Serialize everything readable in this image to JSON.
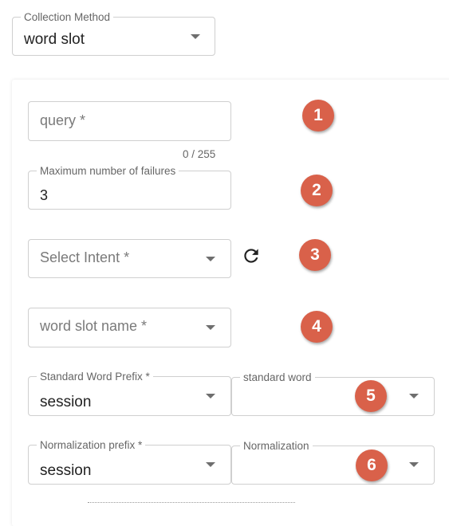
{
  "collection_method": {
    "label": "Collection Method",
    "value": "word slot"
  },
  "query": {
    "placeholder": "query *",
    "counter": "0 / 255"
  },
  "max_failures": {
    "label": "Maximum number of failures",
    "value": "3"
  },
  "intent": {
    "placeholder": "Select Intent *"
  },
  "word_slot_name": {
    "placeholder": "word slot name *"
  },
  "standard_word_prefix": {
    "label": "Standard Word Prefix *",
    "value": "session"
  },
  "standard_word": {
    "label": "standard word",
    "value": ""
  },
  "normalization_prefix": {
    "label": "Normalization prefix *",
    "value": "session"
  },
  "normalization": {
    "label": "Normalization",
    "value": ""
  },
  "badges": [
    "1",
    "2",
    "3",
    "4",
    "5",
    "6"
  ],
  "colors": {
    "badge": "#d9614a",
    "border": "#cfcfcf"
  },
  "icons": {
    "refresh": "refresh-icon",
    "dropdown": "chevron-down-icon"
  }
}
